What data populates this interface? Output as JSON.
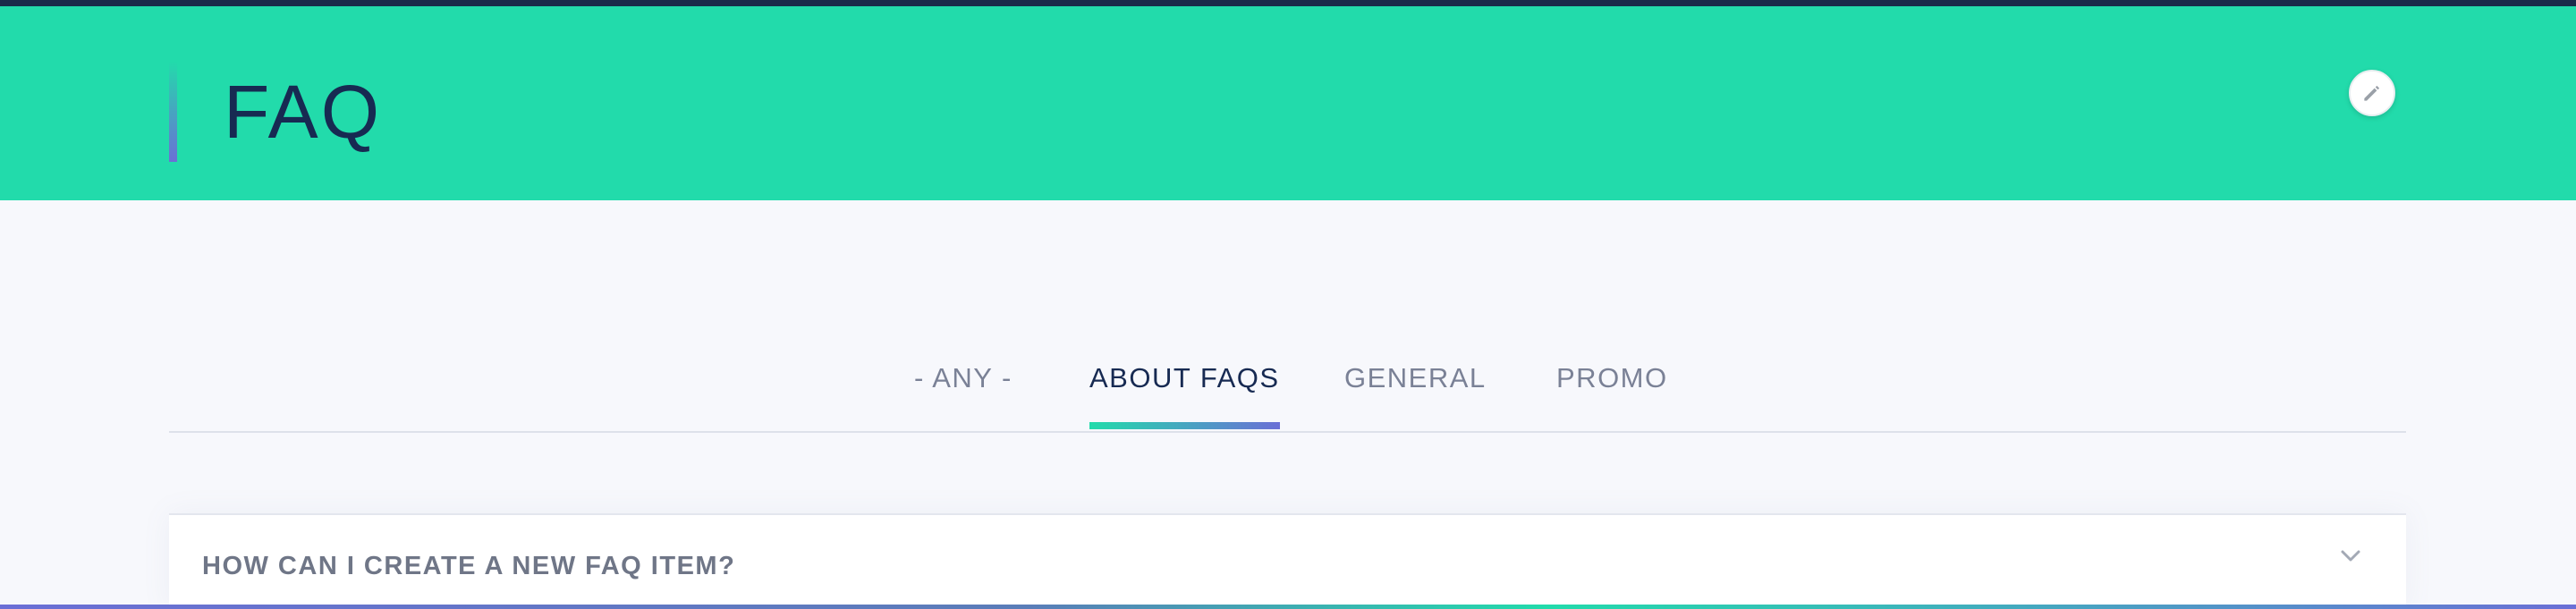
{
  "header": {
    "title": "FAQ",
    "edit_icon": "pencil-icon"
  },
  "colors": {
    "accent": "#22dbab",
    "title_text": "#172a52",
    "gradient_end": "#6b6fd6",
    "tab_inactive": "#7a8196"
  },
  "tabs": [
    {
      "label": "- ANY -",
      "active": false
    },
    {
      "label": "ABOUT FAQS",
      "active": true
    },
    {
      "label": "GENERAL",
      "active": false
    },
    {
      "label": "PROMO",
      "active": false
    }
  ],
  "faq": {
    "items": [
      {
        "question": "HOW CAN I CREATE A NEW FAQ ITEM?",
        "icon": "chevron-down-icon"
      }
    ]
  }
}
